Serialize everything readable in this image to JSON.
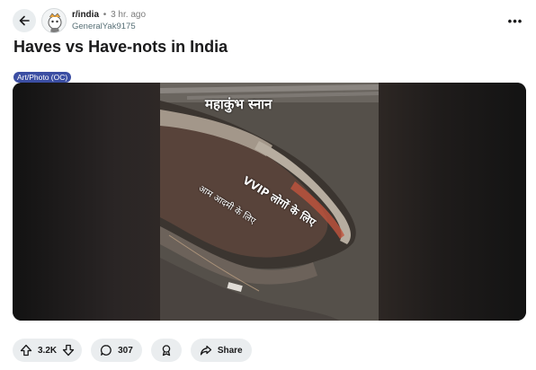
{
  "post": {
    "subreddit": "r/india",
    "separator": "•",
    "time": "3 hr. ago",
    "author": "GeneralYak9175",
    "title": "Haves vs Have-nots in India",
    "flair": "Art/Photo (OC)",
    "more": "•••"
  },
  "media": {
    "caption_top": "महाकुंभ स्नान",
    "caption_vvip": "VVIP लोगों के लिए",
    "caption_common": "आम आदमी के लिए"
  },
  "actions": {
    "score": "3.2K",
    "comments": "307",
    "share_label": "Share"
  },
  "icons": [
    "back-arrow-icon",
    "subreddit-avatar-icon",
    "more-options-icon",
    "upvote-icon",
    "downvote-icon",
    "comment-icon",
    "award-icon",
    "share-icon"
  ]
}
